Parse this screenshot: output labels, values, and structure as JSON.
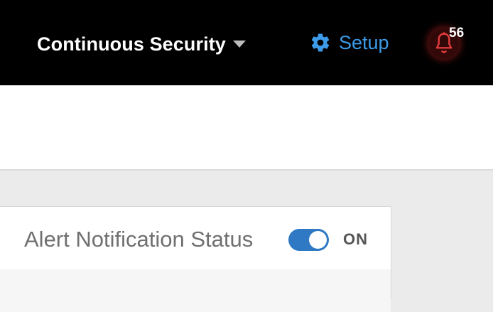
{
  "topbar": {
    "product_name": "Continuous Security",
    "setup_label": "Setup",
    "notification_count": "56"
  },
  "alert_settings": {
    "status_label": "Alert Notification Status",
    "toggle_state": "ON",
    "toggle_on": true
  },
  "icons": {
    "product_switcher": "caret-down-icon",
    "setup": "gear-icon",
    "notifications": "bell-icon"
  },
  "colors": {
    "topbar_bg": "#000000",
    "setup_accent": "#3d9be9",
    "bell_alert": "#e23b3b",
    "toggle_on": "#2e78c4"
  }
}
